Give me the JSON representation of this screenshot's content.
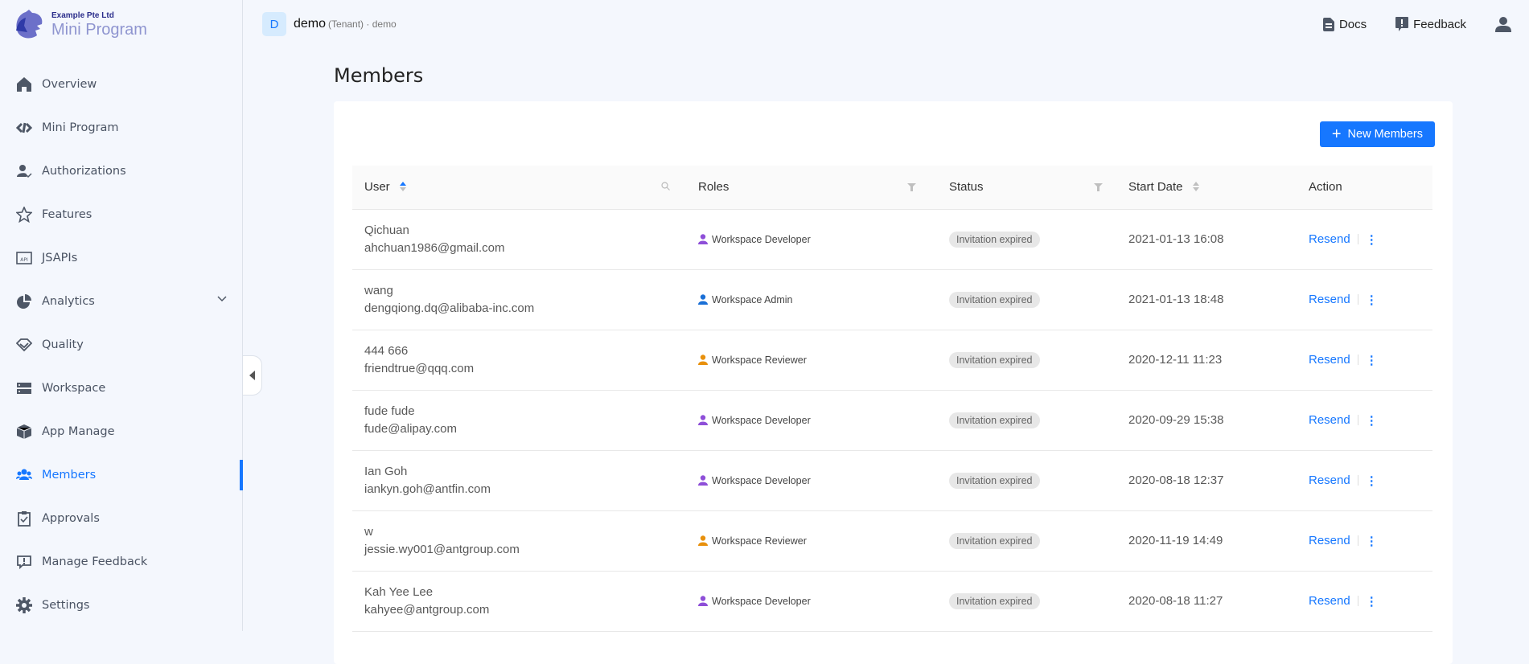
{
  "brand": {
    "company": "Example Pte Ltd",
    "app": "Mini Program"
  },
  "sidebar": {
    "items": [
      {
        "label": "Overview",
        "icon": "home-icon"
      },
      {
        "label": "Mini Program",
        "icon": "link-icon"
      },
      {
        "label": "Authorizations",
        "icon": "user-check-icon"
      },
      {
        "label": "Features",
        "icon": "star-icon"
      },
      {
        "label": "JSAPIs",
        "icon": "api-icon"
      },
      {
        "label": "Analytics",
        "icon": "pie-chart-icon"
      },
      {
        "label": "Quality",
        "icon": "diamond-icon"
      },
      {
        "label": "Workspace",
        "icon": "server-icon"
      },
      {
        "label": "App Manage",
        "icon": "cube-icon"
      },
      {
        "label": "Members",
        "icon": "team-icon",
        "active": true
      },
      {
        "label": "Approvals",
        "icon": "clipboard-check-icon"
      },
      {
        "label": "Manage Feedback",
        "icon": "feedback-icon"
      },
      {
        "label": "Settings",
        "icon": "gear-icon"
      }
    ]
  },
  "header": {
    "tenant_initial": "D",
    "tenant_name": "demo",
    "tenant_sub": "(Tenant) · demo",
    "docs": "Docs",
    "feedback": "Feedback"
  },
  "page": {
    "title": "Members",
    "new_button": "New Members"
  },
  "table": {
    "columns": [
      "User",
      "Roles",
      "Status",
      "Start Date",
      "Action"
    ],
    "rows": [
      {
        "name": "Qichuan",
        "email": "ahchuan1986@gmail.com",
        "role": "Workspace Developer",
        "role_color": "#8e4fd8",
        "status": "Invitation expired",
        "date": "2021-01-13 16:08",
        "action": "Resend"
      },
      {
        "name": "wang",
        "email": "dengqiong.dq@alibaba-inc.com",
        "role": "Workspace Admin",
        "role_color": "#1a6fd6",
        "status": "Invitation expired",
        "date": "2021-01-13 18:48",
        "action": "Resend"
      },
      {
        "name": "444 666",
        "email": "friendtrue@qqq.com",
        "role": "Workspace Reviewer",
        "role_color": "#e8900c",
        "status": "Invitation expired",
        "date": "2020-12-11 11:23",
        "action": "Resend"
      },
      {
        "name": "fude fude",
        "email": "fude@alipay.com",
        "role": "Workspace Developer",
        "role_color": "#8e4fd8",
        "status": "Invitation expired",
        "date": "2020-09-29 15:38",
        "action": "Resend"
      },
      {
        "name": "Ian Goh",
        "email": "iankyn.goh@antfin.com",
        "role": "Workspace Developer",
        "role_color": "#8e4fd8",
        "status": "Invitation expired",
        "date": "2020-08-18 12:37",
        "action": "Resend"
      },
      {
        "name": "w",
        "email": "jessie.wy001@antgroup.com",
        "role": "Workspace Reviewer",
        "role_color": "#e8900c",
        "status": "Invitation expired",
        "date": "2020-11-19 14:49",
        "action": "Resend"
      },
      {
        "name": "Kah Yee Lee",
        "email": "kahyee@antgroup.com",
        "role": "Workspace Developer",
        "role_color": "#8e4fd8",
        "status": "Invitation expired",
        "date": "2020-08-18 11:27",
        "action": "Resend"
      }
    ]
  }
}
